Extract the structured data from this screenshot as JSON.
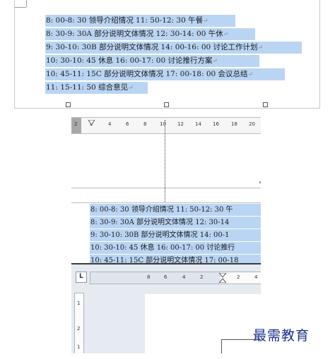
{
  "top_lines": [
    "8: 00-8: 30 领导介绍情况 11: 50-12: 30 午餐",
    "8: 30-9: 30A 部分说明文体情况 12: 30-14: 00 午休",
    "9: 30-10: 30B 部分说明文体情况 14: 00-16: 00 讨论工作计划",
    "10: 30-10: 45 休息 16: 00-17: 00 讨论推行方案",
    "10: 45-11: 15C 部分说明文体情况 17: 00-18: 00 会议总结",
    "11: 15-11: 50 综合意见"
  ],
  "para_mark": "↵",
  "ruler1_ticks": [
    "2",
    "2",
    "4",
    "6",
    "8",
    "10",
    "12",
    "14",
    "16",
    "18",
    "20"
  ],
  "mid_lines": [
    "8: 00-8: 30 领导介绍情况 11: 50-12: 30 午",
    "8: 30-9: 30A 部分说明文体情况 12: 30-14",
    "9: 30-10: 30B 部分说明文体情况 14: 00-1",
    "10: 30-10: 45 休息 16: 00-17: 00 讨论推行",
    "10: 45-11: 15C 部分说明文体情况 17: 00-18"
  ],
  "ruler2_ticks": [
    "8",
    "6",
    "4",
    "2",
    "2",
    "4"
  ],
  "vruler_ticks": [
    "1",
    "2",
    "1"
  ],
  "tab_selector": "L",
  "watermark": "最需教育",
  "colors": {
    "selection": "#b9d5f3",
    "watermark": "#1c2f8c"
  }
}
